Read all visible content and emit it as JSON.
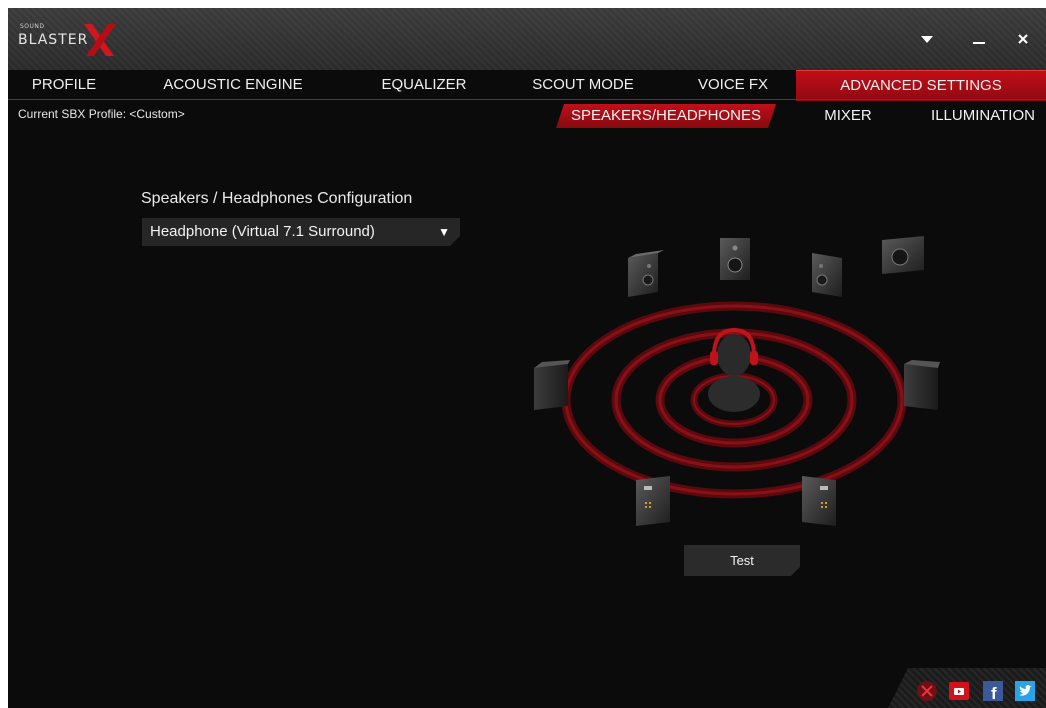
{
  "app": {
    "logo_small": "SOUND",
    "logo_word": "BLASTER",
    "accent_color": "#c10d18"
  },
  "window_controls": {
    "menu_icon": "dropdown-triangle-icon",
    "minimize_icon": "minimize-icon",
    "close_icon": "close-icon"
  },
  "nav": {
    "tabs": [
      {
        "label": "PROFILE"
      },
      {
        "label": "ACOUSTIC ENGINE"
      },
      {
        "label": "EQUALIZER"
      },
      {
        "label": "SCOUT MODE"
      },
      {
        "label": "VOICE FX"
      },
      {
        "label": "ADVANCED SETTINGS",
        "active": true
      }
    ]
  },
  "profile": {
    "label": "Current SBX Profile: <Custom>"
  },
  "subtabs": [
    {
      "label": "SPEAKERS/HEADPHONES",
      "active": true
    },
    {
      "label": "MIXER"
    },
    {
      "label": "ILLUMINATION"
    }
  ],
  "config": {
    "heading": "Speakers / Headphones Configuration",
    "selected": "Headphone (Virtual 7.1 Surround)"
  },
  "test_button": {
    "label": "Test"
  },
  "social": {
    "icons": [
      "close-circle-icon",
      "youtube-icon",
      "facebook-icon",
      "twitter-icon"
    ]
  }
}
